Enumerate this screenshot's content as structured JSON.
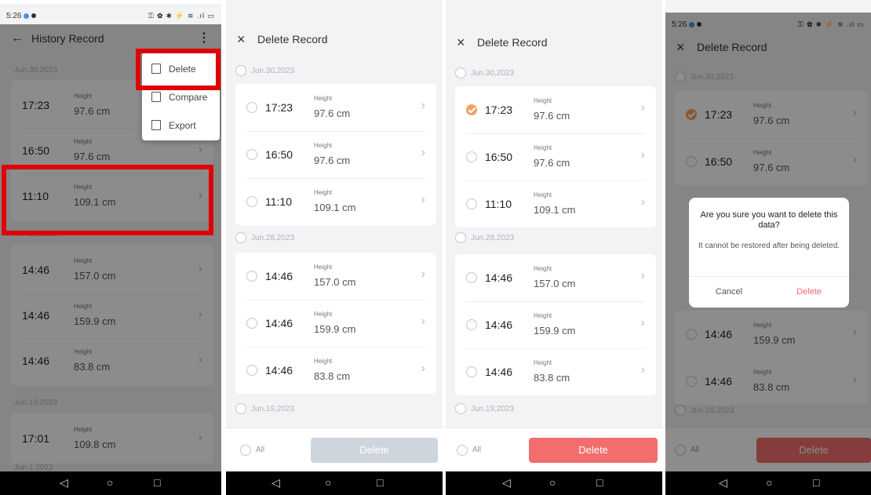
{
  "status_bar": {
    "time": "5:26",
    "icons": "⚿ ✿ ✱ ⚡ ≋ .ıl ▭"
  },
  "navbar": {
    "back": "◁",
    "home": "○",
    "recent": "□"
  },
  "colors": {
    "accent_delete": "#f26d6d",
    "highlight_box": "#e00000",
    "checked": "#f4a261"
  },
  "panel1": {
    "back_icon": "←",
    "title": "History Record",
    "more_icon": "⋮",
    "menu": [
      {
        "label": "Delete",
        "icon": "trash-icon"
      },
      {
        "label": "Compare",
        "icon": "compare-icon"
      },
      {
        "label": "Export",
        "icon": "export-icon"
      }
    ],
    "groups": [
      {
        "date": "Jun.30,2023",
        "rows": [
          {
            "time": "17:23",
            "label": "Height",
            "value": "97.6 cm"
          },
          {
            "time": "16:50",
            "label": "Height",
            "value": "97.6 cm"
          },
          {
            "time": "11:10",
            "label": "Height",
            "value": "109.1 cm"
          }
        ]
      },
      {
        "date": "Jun.28,2023",
        "rows": [
          {
            "time": "14:46",
            "label": "Height",
            "value": "157.0 cm"
          },
          {
            "time": "14:46",
            "label": "Height",
            "value": "159.9 cm"
          },
          {
            "time": "14:46",
            "label": "Height",
            "value": "83.8 cm"
          }
        ]
      },
      {
        "date": "Jun.19,2023",
        "rows": [
          {
            "time": "17:01",
            "label": "Height",
            "value": "109.8 cm"
          }
        ]
      },
      {
        "date": "Jun.1,2023",
        "rows": []
      }
    ]
  },
  "panel2": {
    "close_icon": "×",
    "title": "Delete Record",
    "groups": [
      {
        "date": "Jun.30,2023",
        "rows": [
          {
            "time": "17:23",
            "label": "Height",
            "value": "97.6 cm",
            "checked": false
          },
          {
            "time": "16:50",
            "label": "Height",
            "value": "97.6 cm",
            "checked": false
          },
          {
            "time": "11:10",
            "label": "Height",
            "value": "109.1 cm",
            "checked": false
          }
        ]
      },
      {
        "date": "Jun.28,2023",
        "rows": [
          {
            "time": "14:46",
            "label": "Height",
            "value": "157.0 cm",
            "checked": false
          },
          {
            "time": "14:46",
            "label": "Height",
            "value": "159.9 cm",
            "checked": false
          },
          {
            "time": "14:46",
            "label": "Height",
            "value": "83.8 cm",
            "checked": false
          }
        ]
      },
      {
        "date": "Jun.19,2023",
        "rows": []
      }
    ],
    "all_label": "All",
    "delete_label": "Delete"
  },
  "panel3": {
    "close_icon": "×",
    "title": "Delete Record",
    "groups": [
      {
        "date": "Jun.30,2023",
        "rows": [
          {
            "time": "17:23",
            "label": "Height",
            "value": "97.6 cm",
            "checked": true
          },
          {
            "time": "16:50",
            "label": "Height",
            "value": "97.6 cm",
            "checked": false
          },
          {
            "time": "11:10",
            "label": "Height",
            "value": "109.1 cm",
            "checked": false
          }
        ]
      },
      {
        "date": "Jun.28,2023",
        "rows": [
          {
            "time": "14:46",
            "label": "Height",
            "value": "157.0 cm",
            "checked": false
          },
          {
            "time": "14:46",
            "label": "Height",
            "value": "159.9 cm",
            "checked": false
          },
          {
            "time": "14:46",
            "label": "Height",
            "value": "83.8 cm",
            "checked": false
          }
        ]
      },
      {
        "date": "Jun.19,2023",
        "rows": []
      }
    ],
    "all_label": "All",
    "delete_label": "Delete"
  },
  "panel4": {
    "close_icon": "×",
    "title": "Delete Record",
    "groups": [
      {
        "date": "Jun.30,2023",
        "rows": [
          {
            "time": "17:23",
            "label": "Height",
            "value": "97.6 cm",
            "checked": true
          },
          {
            "time": "16:50",
            "label": "Height",
            "value": "97.6 cm",
            "checked": false
          }
        ]
      },
      {
        "date": "",
        "rows": [
          {
            "time": "14:46",
            "label": "Height",
            "value": "159.9 cm",
            "checked": false
          },
          {
            "time": "14:46",
            "label": "Height",
            "value": "83.8 cm",
            "checked": false
          }
        ]
      },
      {
        "date": "Jun.19,2023",
        "rows": []
      }
    ],
    "all_label": "All",
    "delete_label": "Delete",
    "dialog": {
      "title": "Are you sure you want to delete this data?",
      "message": "It cannot be restored after being deleted.",
      "cancel": "Cancel",
      "confirm": "Delete"
    }
  }
}
